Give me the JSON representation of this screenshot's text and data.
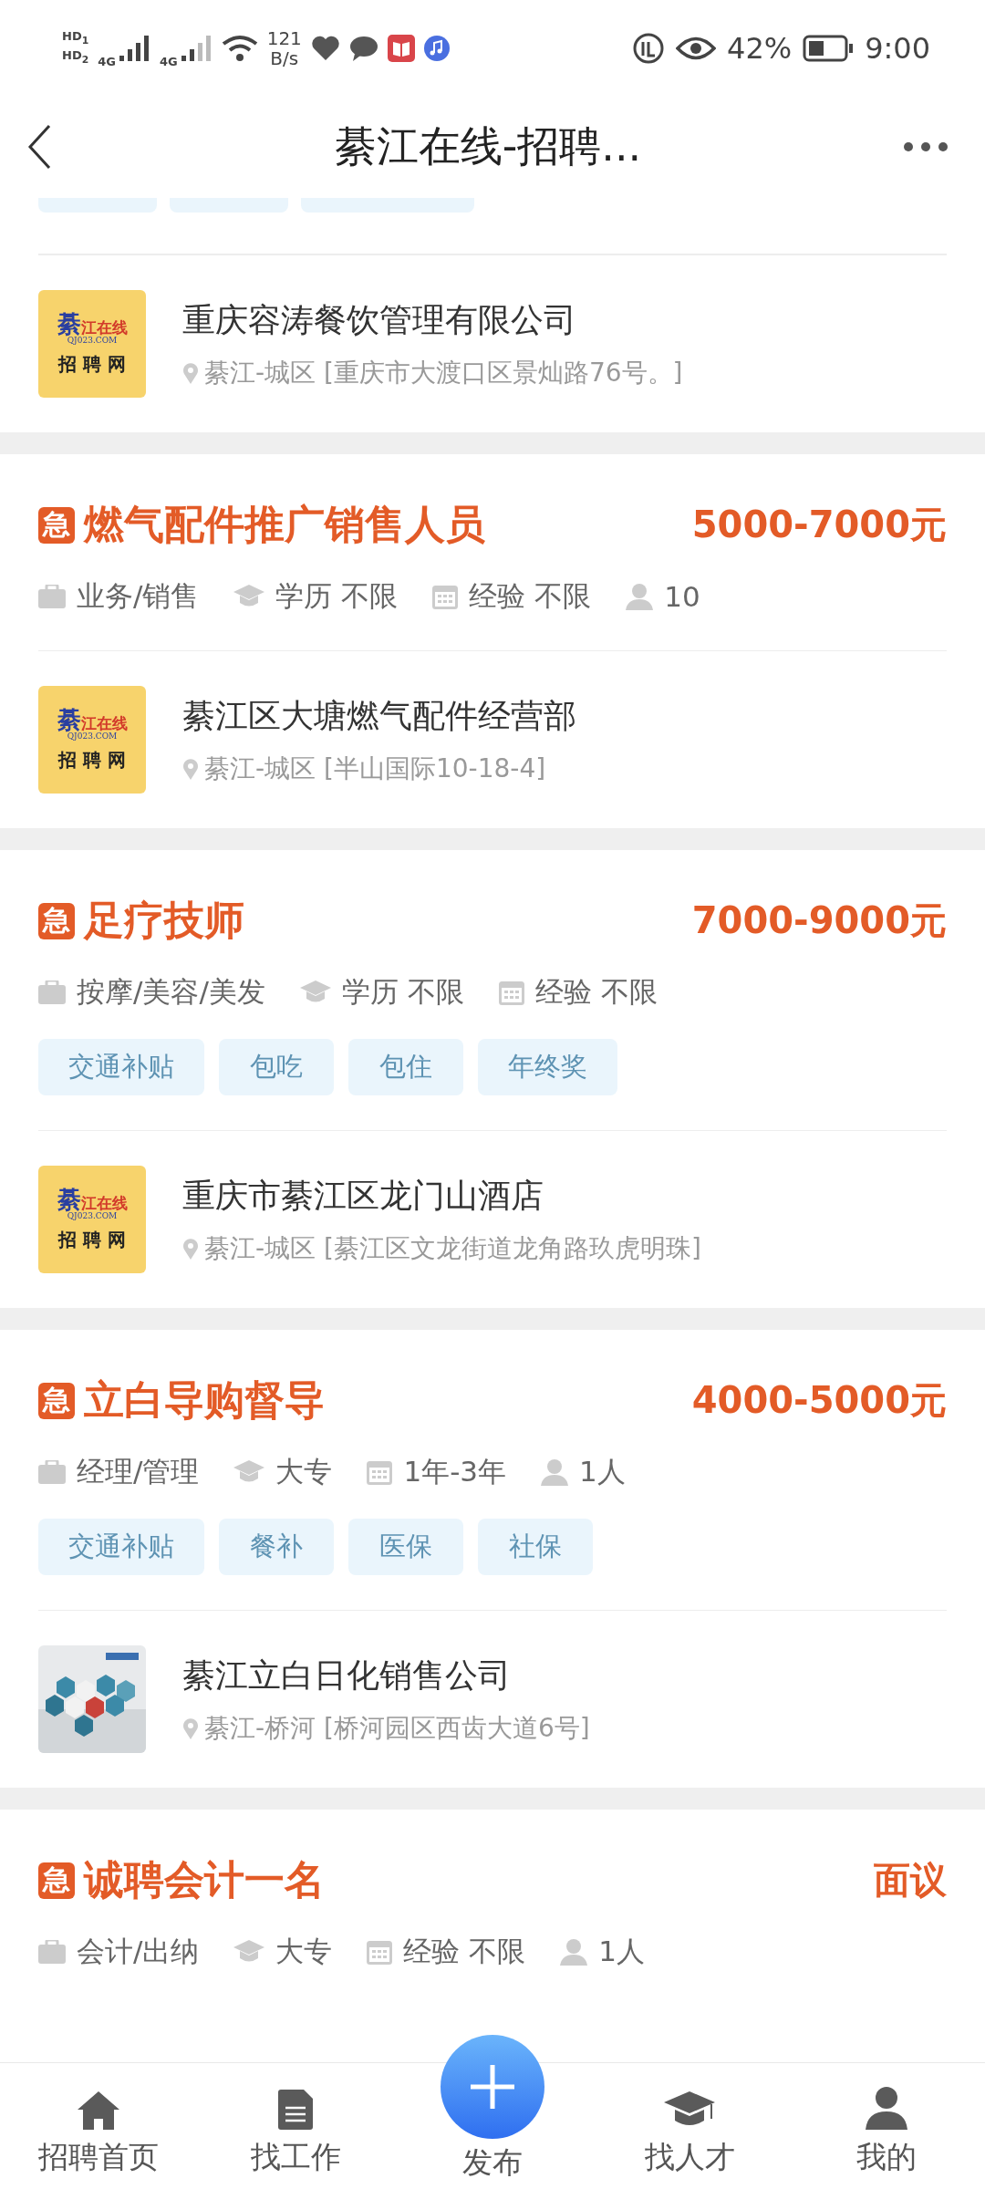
{
  "status_bar": {
    "hd": [
      "HD$_{1}$",
      "HD$_{2}$"
    ],
    "networks": [
      "4G",
      "4G"
    ],
    "speed": [
      "121",
      "B/s"
    ],
    "battery": "42%",
    "time": "9:00"
  },
  "header": {
    "title": "綦江在线-招聘..."
  },
  "cut_tags": [
    {
      "kind": "tag"
    },
    {
      "kind": "tag"
    },
    {
      "kind": "tag"
    }
  ],
  "top_company": {
    "logo": {
      "kind": "logo",
      "mark": "綦",
      "name": "江在线",
      "domain": "QJ023.COM",
      "label": "招 聘 网"
    },
    "name": "重庆容涛餐饮管理有限公司",
    "address": "綦江-城区 [重庆市大渡口区景灿路76号。]"
  },
  "jobs": [
    {
      "urgent": true,
      "badge": "急",
      "title": "燃气配件推广销售人员",
      "salary": "5000-7000元",
      "meta": [
        {
          "kind": "category",
          "text": "业务/销售"
        },
        {
          "kind": "education",
          "text": "学历 不限"
        },
        {
          "kind": "experience",
          "text": "经验 不限"
        },
        {
          "kind": "headcount",
          "text": "10"
        }
      ],
      "company": {
        "logo": {
          "kind": "logo",
          "mark": "綦",
          "name": "江在线",
          "domain": "QJ023.COM",
          "label": "招 聘 网"
        },
        "name": "綦江区大塘燃气配件经营部",
        "address": "綦江-城区 [半山国际10-18-4]"
      }
    },
    {
      "urgent": true,
      "badge": "急",
      "title": "足疗技师",
      "salary": "7000-9000元",
      "meta": [
        {
          "kind": "category",
          "text": "按摩/美容/美发"
        },
        {
          "kind": "education",
          "text": "学历 不限"
        },
        {
          "kind": "experience",
          "text": "经验 不限"
        }
      ],
      "tags": [
        "交通补贴",
        "包吃",
        "包住",
        "年终奖"
      ],
      "company": {
        "logo": {
          "kind": "logo",
          "mark": "綦",
          "name": "江在线",
          "domain": "QJ023.COM",
          "label": "招 聘 网"
        },
        "name": "重庆市綦江区龙门山酒店",
        "address": "綦江-城区 [綦江区文龙街道龙角路玖虎明珠]"
      }
    },
    {
      "urgent": true,
      "badge": "急",
      "title": "立白导购督导",
      "salary": "4000-5000元",
      "meta": [
        {
          "kind": "category",
          "text": "经理/管理"
        },
        {
          "kind": "education",
          "text": "大专"
        },
        {
          "kind": "experience",
          "text": "1年-3年"
        },
        {
          "kind": "headcount",
          "text": "1人"
        }
      ],
      "tags": [
        "交通补贴",
        "餐补",
        "医保",
        "社保"
      ],
      "company": {
        "name": "綦江立白日化销售公司",
        "address": "綦江-桥河 [桥河园区西齿大道6号]"
      }
    },
    {
      "urgent": true,
      "badge": "急",
      "title": "诚聘会计一名",
      "salary": "面议",
      "meta": [
        {
          "kind": "category",
          "text": "会计/出纳"
        },
        {
          "kind": "education",
          "text": "大专"
        },
        {
          "kind": "experience",
          "text": "经验 不限"
        },
        {
          "kind": "headcount",
          "text": "1人"
        }
      ]
    }
  ],
  "bottom_nav": [
    {
      "kind": "home",
      "label": "招聘首页"
    },
    {
      "kind": "doc",
      "label": "找工作"
    },
    {
      "kind": "publish",
      "label": "发布"
    },
    {
      "kind": "talent",
      "label": "找人才"
    },
    {
      "kind": "me",
      "label": "我的"
    }
  ]
}
